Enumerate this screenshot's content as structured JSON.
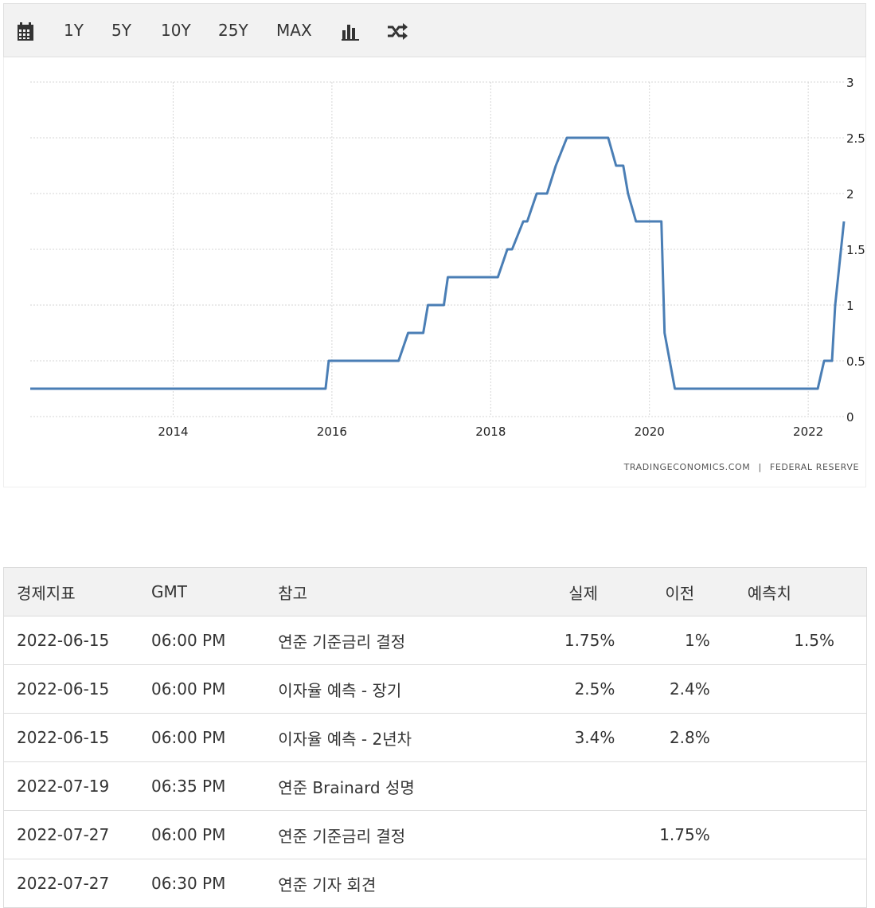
{
  "toolbar": {
    "calendar_icon": "calendar-icon",
    "ranges": [
      "1Y",
      "5Y",
      "10Y",
      "25Y",
      "MAX"
    ],
    "bar_icon": "bar-chart-icon",
    "shuffle_icon": "shuffle-icon"
  },
  "chart_data": {
    "type": "line",
    "title": "",
    "xlabel": "",
    "ylabel": "",
    "xlim": [
      2012.2,
      2022.45
    ],
    "ylim": [
      0,
      3
    ],
    "x_ticks": [
      "2014",
      "2016",
      "2018",
      "2020",
      "2022"
    ],
    "y_ticks": [
      "0",
      "0.5",
      "1",
      "1.5",
      "2",
      "2.5",
      "3"
    ],
    "grid": true,
    "line_color": "#4a7eb5",
    "series": [
      {
        "x": [
          2012.2,
          2015.92,
          2015.96,
          2016.84,
          2016.96,
          2017.15,
          2017.21,
          2017.41,
          2017.46,
          2018.09,
          2018.21,
          2018.27,
          2018.41,
          2018.46,
          2018.58,
          2018.71,
          2018.82,
          2018.96,
          2019.48,
          2019.58,
          2019.67,
          2019.73,
          2019.83,
          2020.15,
          2020.19,
          2020.32,
          2022.12,
          2022.2,
          2022.3,
          2022.34,
          2022.45
        ],
        "y": [
          0.25,
          0.25,
          0.5,
          0.5,
          0.75,
          0.75,
          1.0,
          1.0,
          1.25,
          1.25,
          1.5,
          1.5,
          1.75,
          1.75,
          2.0,
          2.0,
          2.25,
          2.5,
          2.5,
          2.25,
          2.25,
          2.0,
          1.75,
          1.75,
          0.75,
          0.25,
          0.25,
          0.5,
          0.5,
          1.0,
          1.75
        ]
      }
    ],
    "credit_left": "TRADINGECONOMICS.COM",
    "credit_sep": "|",
    "credit_right": "FEDERAL RESERVE"
  },
  "table": {
    "headers": [
      "경제지표",
      "GMT",
      "참고",
      "실제",
      "이전",
      "예측치"
    ],
    "rows": [
      [
        "2022-06-15",
        "06:00 PM",
        "연준 기준금리 결정",
        "1.75%",
        "1%",
        "1.5%"
      ],
      [
        "2022-06-15",
        "06:00 PM",
        "이자율 예측 - 장기",
        "2.5%",
        "2.4%",
        ""
      ],
      [
        "2022-06-15",
        "06:00 PM",
        "이자율 예측 - 2년차",
        "3.4%",
        "2.8%",
        ""
      ],
      [
        "2022-07-19",
        "06:35 PM",
        "연준 Brainard 성명",
        "",
        "",
        ""
      ],
      [
        "2022-07-27",
        "06:00 PM",
        "연준 기준금리 결정",
        "",
        "1.75%",
        ""
      ],
      [
        "2022-07-27",
        "06:30 PM",
        "연준 기자 회견",
        "",
        "",
        ""
      ]
    ]
  }
}
